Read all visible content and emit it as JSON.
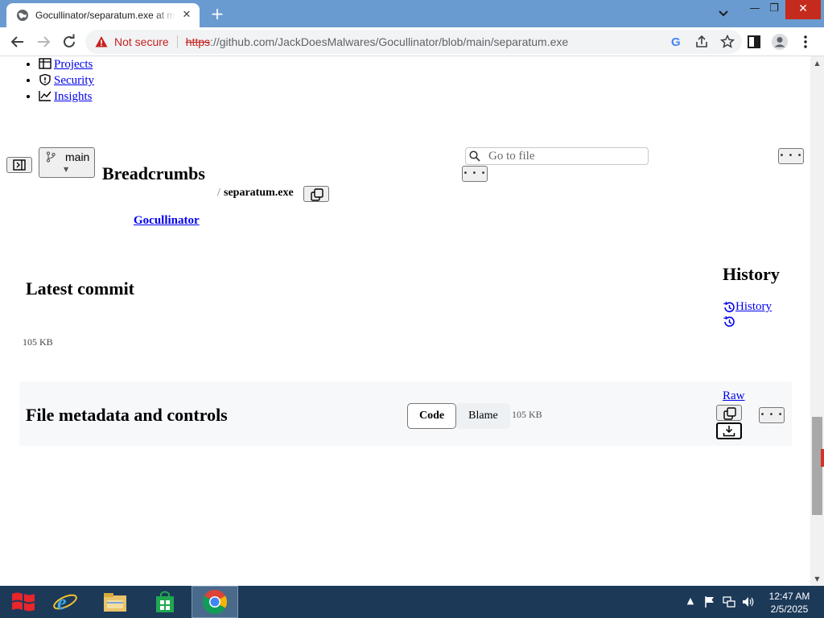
{
  "browser": {
    "tab_title": "Gocullinator/separatum.exe at main · JackDoesMalwares/Gocullinator",
    "tab_close": "✕",
    "new_tab": "+",
    "not_secure": "Not secure",
    "url_scheme": "https",
    "url_rest": "://github.com/JackDoesMalwares/Gocullinator/blob/main/separatum.exe",
    "window_min": "—",
    "window_restore": "❐",
    "window_close": "✕"
  },
  "page": {
    "nav_items": [
      {
        "label": "Projects",
        "icon": "table-icon"
      },
      {
        "label": "Security",
        "icon": "shield-icon"
      },
      {
        "label": "Insights",
        "icon": "graph-icon"
      }
    ],
    "branch": "main",
    "breadcrumbs_heading": "Breadcrumbs",
    "crumb_sep": "/",
    "file_name": "separatum.exe",
    "repo_link": "Gocullinator",
    "goto_placeholder": "Go to file",
    "more_dots": "• • •",
    "latest_commit_heading": "Latest commit",
    "history_heading": "History",
    "history_link": "History",
    "file_size": "105 KB",
    "file_metadata_heading": "File metadata and controls",
    "code_tab": "Code",
    "blame_tab": "Blame",
    "file_size_2": "105 KB",
    "raw_link": "Raw"
  },
  "taskbar": {
    "time": "12:47 AM",
    "date": "2/5/2025",
    "tray_up": "▲"
  },
  "colors": {
    "tab_strip": "#6a9bd0",
    "link": "#0000ee",
    "warning": "#c5221f",
    "taskbar": "#1c3958"
  }
}
